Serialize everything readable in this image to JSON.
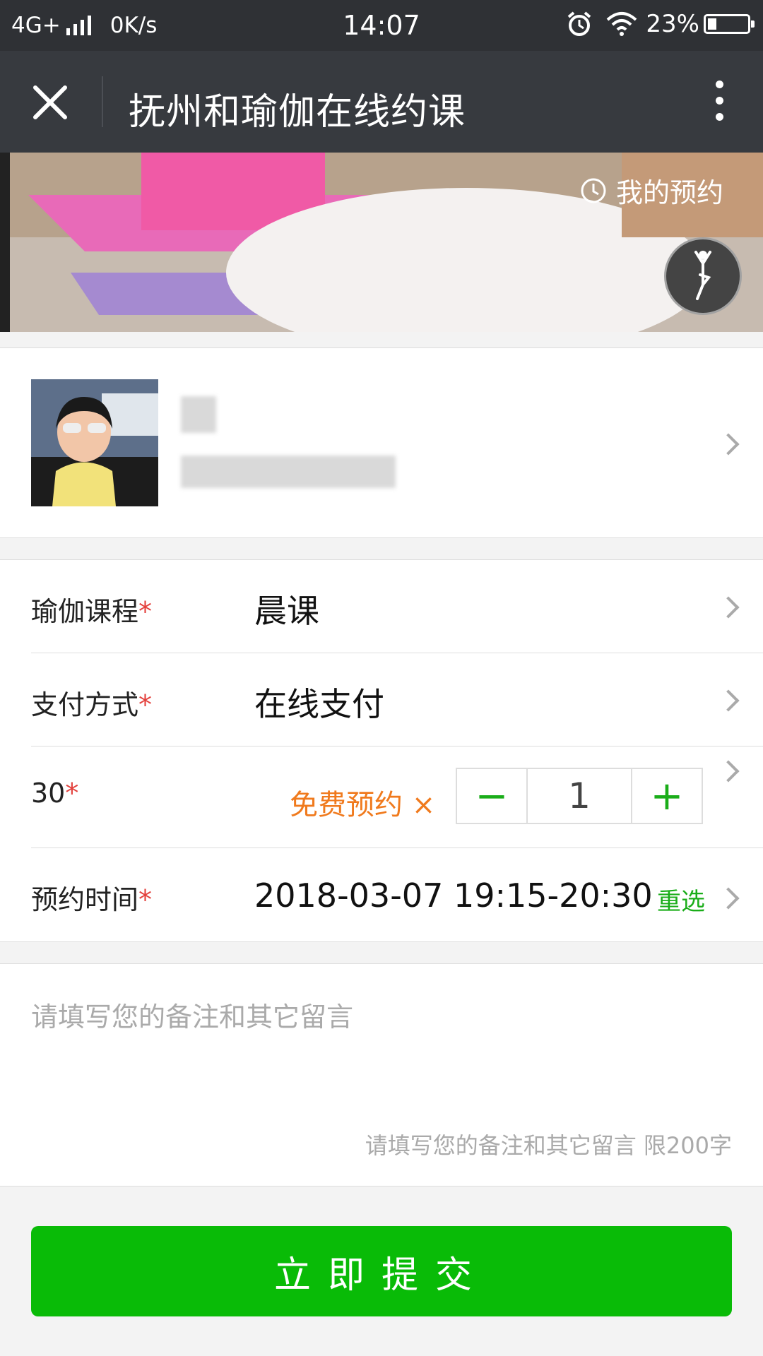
{
  "status_bar": {
    "network": "4G+",
    "speed": "0K/s",
    "time": "14:07",
    "battery": "23%"
  },
  "nav": {
    "title": "抚州和瑜伽在线约课"
  },
  "banner": {
    "my_booking_label": "我的预约"
  },
  "form": {
    "course": {
      "label": "瑜伽课程",
      "required": "*",
      "value": "晨课"
    },
    "payment": {
      "label": "支付方式",
      "required": "*",
      "value": "在线支付"
    },
    "quantity": {
      "label": "30",
      "required": "*",
      "free_label": "免费预约 ×",
      "minus": "−",
      "value": "1",
      "plus": "+"
    },
    "time": {
      "label": "预约时间",
      "required": "*",
      "value": "2018-03-07 19:15-20:30",
      "reselect_label": "重选"
    }
  },
  "note": {
    "placeholder": "请填写您的备注和其它留言",
    "hint": "请填写您的备注和其它留言 限200字"
  },
  "submit_label": "立即提交",
  "colors": {
    "accent_green": "#09bb07",
    "orange": "#f07a1d",
    "required_red": "#e3403c",
    "nav_bg": "#373a3f"
  }
}
